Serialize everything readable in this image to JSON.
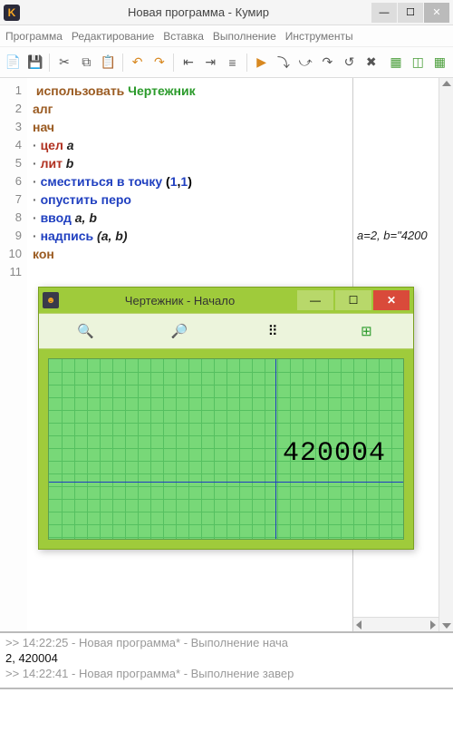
{
  "window": {
    "app_letter": "K",
    "title": "Новая программа - Кумир",
    "min": "—",
    "max": "☐",
    "close": "✕"
  },
  "menu": {
    "program": "Программа",
    "edit": "Редактирование",
    "insert": "Вставка",
    "run": "Выполнение",
    "tools": "Инструменты"
  },
  "code": {
    "lines": [
      "1",
      "2",
      "3",
      "4",
      "5",
      "6",
      "7",
      "8",
      "9",
      "10",
      "11"
    ],
    "l1a": "использовать ",
    "l1b": "Чертежник",
    "l2": "алг",
    "l3": "нач",
    "l4a": "цел",
    "l4b": " a",
    "l5a": "лит",
    "l5b": " b",
    "l6a": "сместиться в точку ",
    "l6b": "(",
    "l6c": "1",
    "l6d": ",",
    "l6e": "1",
    "l6f": ")",
    "l7": "опустить перо",
    "l8a": "ввод",
    "l8b": " a, b",
    "l9a": "надпись",
    "l9b": " (a, b)",
    "l10": "кон"
  },
  "side": {
    "vars": "a=2, b=\"4200"
  },
  "child": {
    "title": "Чертежник - Начало",
    "min": "—",
    "max": "☐",
    "close": "✕",
    "text": "420004"
  },
  "console": {
    "l1": ">> 14:22:25 - Новая программа* - Выполнение нача",
    "l2": "2, 420004",
    "l3": ">> 14:22:41 - Новая программа* - Выполнение завер"
  }
}
